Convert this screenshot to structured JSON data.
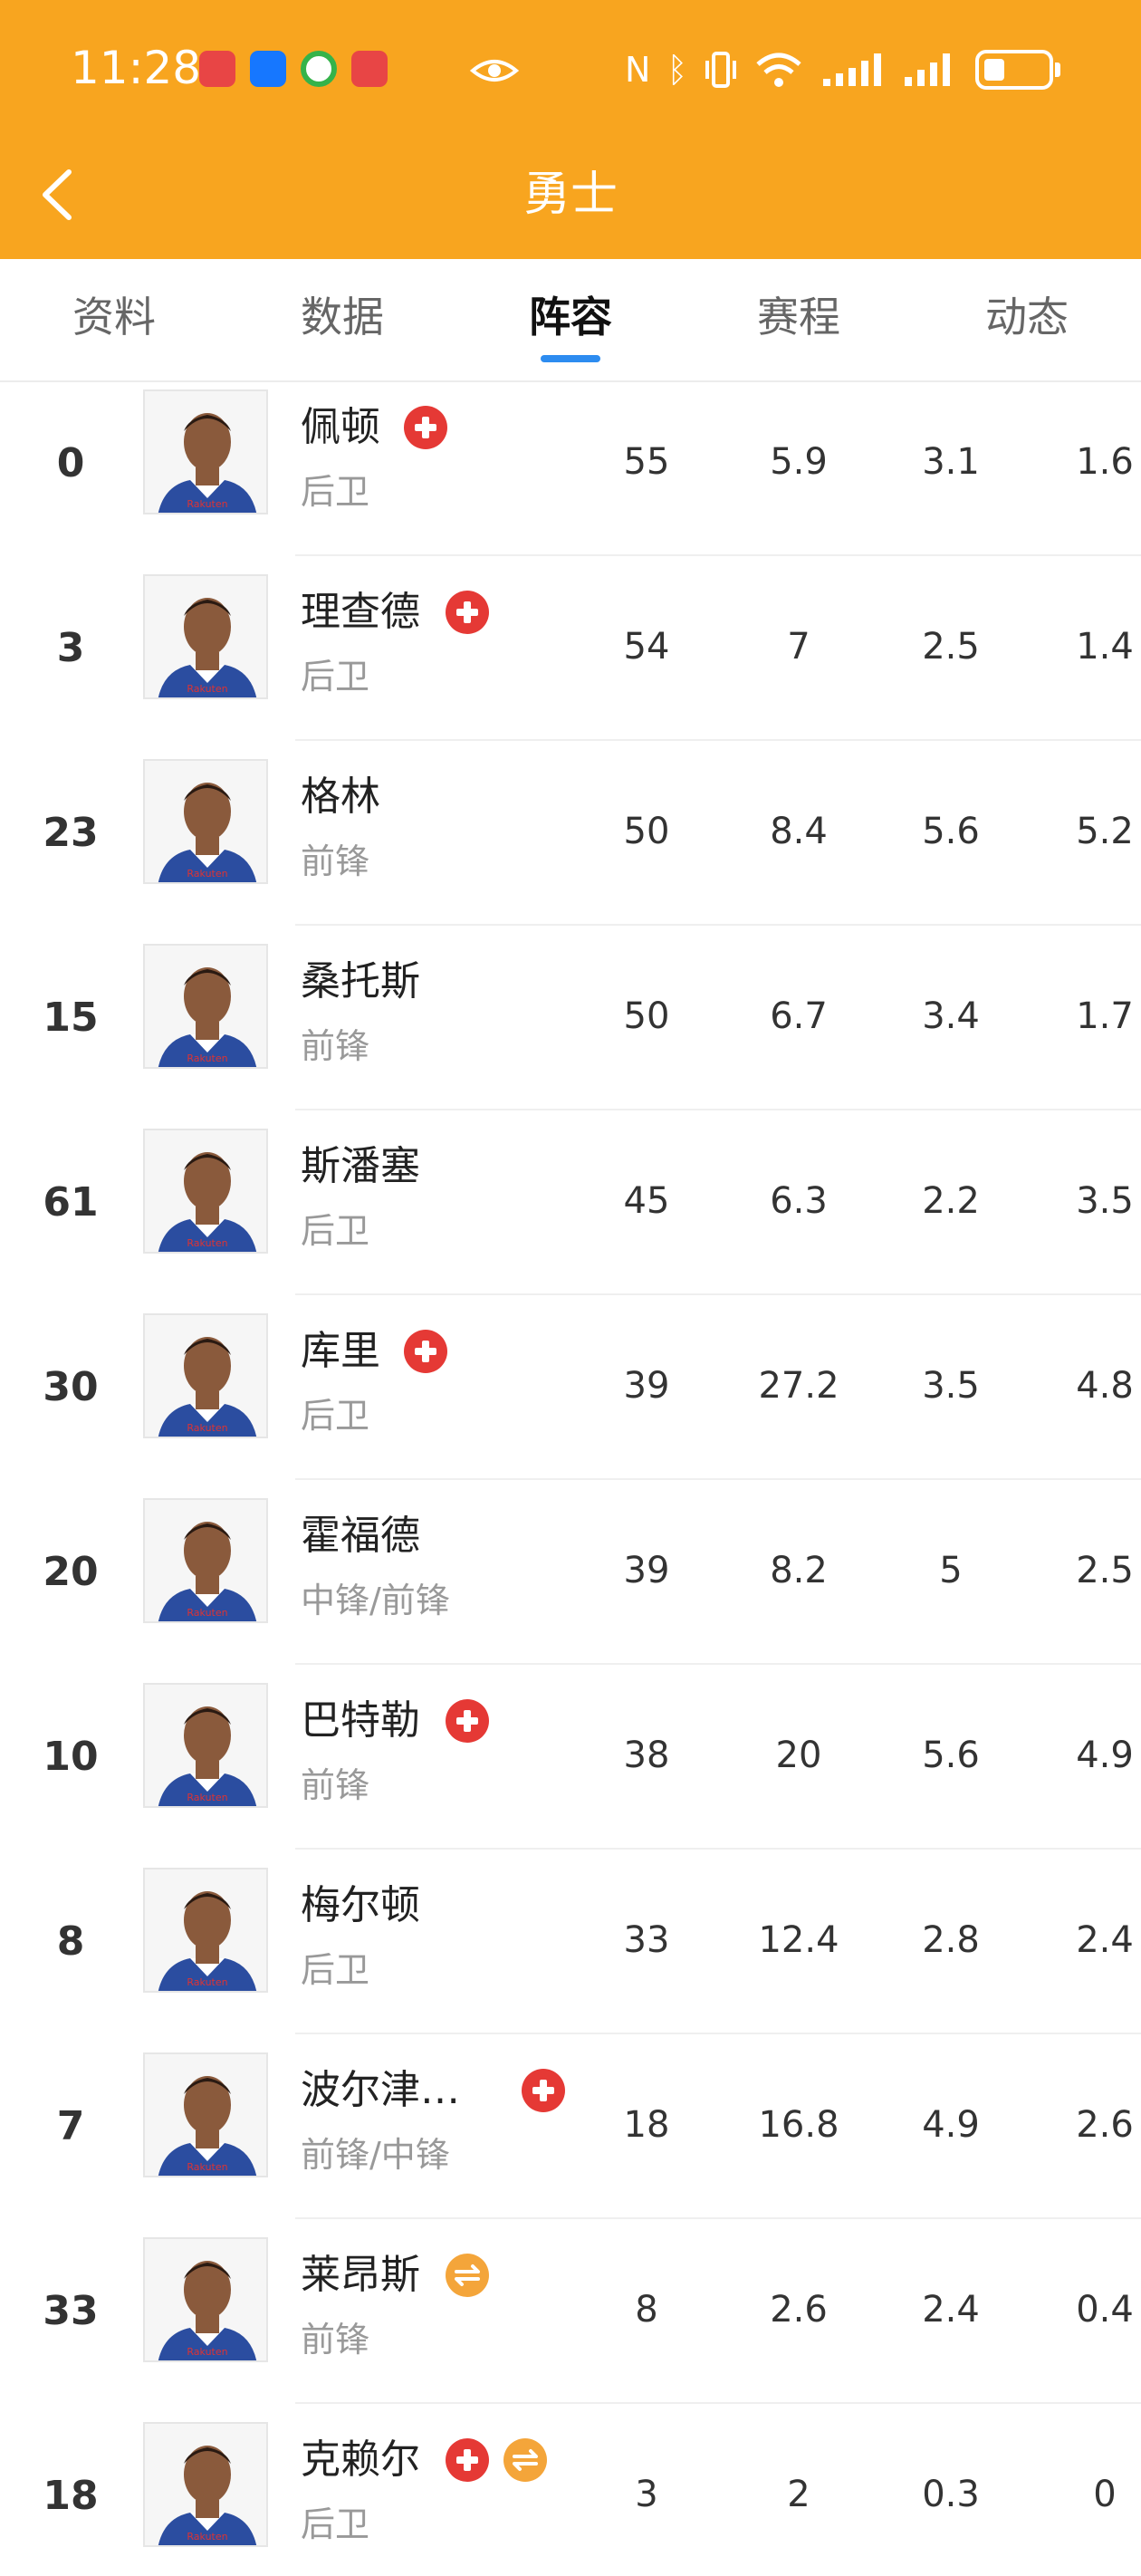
{
  "status_bar": {
    "time": "11:28",
    "icons": [
      "huawei-app-icon",
      "alipay-icon",
      "green-app-icon",
      "huawei-app-icon",
      "eye-icon",
      "nfc-icon",
      "bluetooth-icon",
      "vibrate-icon",
      "wifi-icon",
      "signal-icon",
      "signal-icon",
      "battery-icon"
    ]
  },
  "header": {
    "title": "勇士"
  },
  "tabs": [
    {
      "label": "资料",
      "active": false
    },
    {
      "label": "数据",
      "active": false
    },
    {
      "label": "阵容",
      "active": true
    },
    {
      "label": "赛程",
      "active": false
    },
    {
      "label": "动态",
      "active": false
    }
  ],
  "colors": {
    "header": "#f8a51f",
    "tab_indicator": "#2d8cf0",
    "injury_badge": "#e53935",
    "transfer_badge": "#f4a53a"
  },
  "players": [
    {
      "number": "0",
      "name": "佩顿",
      "position": "后卫",
      "injury": true,
      "transfer": false,
      "stats": [
        "55",
        "5.9",
        "3.1",
        "1.6"
      ]
    },
    {
      "number": "3",
      "name": "理查德",
      "position": "后卫",
      "injury": true,
      "transfer": false,
      "stats": [
        "54",
        "7",
        "2.5",
        "1.4"
      ]
    },
    {
      "number": "23",
      "name": "格林",
      "position": "前锋",
      "injury": false,
      "transfer": false,
      "stats": [
        "50",
        "8.4",
        "5.6",
        "5.2"
      ]
    },
    {
      "number": "15",
      "name": "桑托斯",
      "position": "前锋",
      "injury": false,
      "transfer": false,
      "stats": [
        "50",
        "6.7",
        "3.4",
        "1.7"
      ]
    },
    {
      "number": "61",
      "name": "斯潘塞",
      "position": "后卫",
      "injury": false,
      "transfer": false,
      "stats": [
        "45",
        "6.3",
        "2.2",
        "3.5"
      ]
    },
    {
      "number": "30",
      "name": "库里",
      "position": "后卫",
      "injury": true,
      "transfer": false,
      "stats": [
        "39",
        "27.2",
        "3.5",
        "4.8"
      ]
    },
    {
      "number": "20",
      "name": "霍福德",
      "position": "中锋/前锋",
      "injury": false,
      "transfer": false,
      "stats": [
        "39",
        "8.2",
        "5",
        "2.5"
      ]
    },
    {
      "number": "10",
      "name": "巴特勒",
      "position": "前锋",
      "injury": true,
      "transfer": false,
      "stats": [
        "38",
        "20",
        "5.6",
        "4.9"
      ]
    },
    {
      "number": "8",
      "name": "梅尔顿",
      "position": "后卫",
      "injury": false,
      "transfer": false,
      "stats": [
        "33",
        "12.4",
        "2.8",
        "2.4"
      ]
    },
    {
      "number": "7",
      "name": "波尔津…",
      "position": "前锋/中锋",
      "injury": true,
      "transfer": false,
      "stats": [
        "18",
        "16.8",
        "4.9",
        "2.6"
      ]
    },
    {
      "number": "33",
      "name": "莱昂斯",
      "position": "前锋",
      "injury": false,
      "transfer": true,
      "stats": [
        "8",
        "2.6",
        "2.4",
        "0.4"
      ]
    },
    {
      "number": "18",
      "name": "克赖尔",
      "position": "后卫",
      "injury": true,
      "transfer": true,
      "stats": [
        "3",
        "2",
        "0.3",
        "0"
      ]
    }
  ]
}
